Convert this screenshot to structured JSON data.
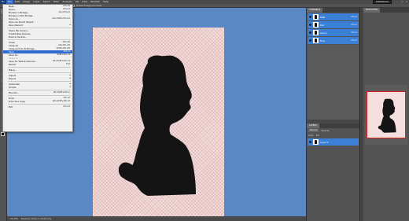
{
  "menubar": {
    "logo": "Ps",
    "items": [
      "File",
      "Edit",
      "Image",
      "Layer",
      "Select",
      "Filter",
      "Analysis",
      "3D",
      "View",
      "Window",
      "Help"
    ],
    "workspace_label": "ESSENTIALS"
  },
  "options": {
    "sample_label": "Protect Foreground Color"
  },
  "file_menu": {
    "items": [
      {
        "label": "New...",
        "shortcut": "Ctrl+N"
      },
      {
        "label": "Open...",
        "shortcut": "Ctrl+O"
      },
      {
        "label": "Browse in Bridge...",
        "shortcut": "Alt+Ctrl+O"
      },
      {
        "label": "Browse in Mini Bridge...",
        "shortcut": ""
      },
      {
        "label": "Open As...",
        "shortcut": "Alt+Shift+Ctrl+O"
      },
      {
        "label": "Open As Smart Object...",
        "shortcut": ""
      },
      {
        "label": "Open Recent",
        "shortcut": ""
      },
      {
        "label": "Share My Screen...",
        "shortcut": ""
      },
      {
        "label": "Create New Review...",
        "shortcut": ""
      },
      {
        "label": "Device Central...",
        "shortcut": ""
      },
      {
        "label": "Close",
        "shortcut": "Ctrl+W"
      },
      {
        "label": "Close All",
        "shortcut": "Alt+Ctrl+W"
      },
      {
        "label": "Close and Go To Bridge...",
        "shortcut": "Shift+Ctrl+W"
      },
      {
        "label": "Save",
        "shortcut": "Ctrl+S"
      },
      {
        "label": "Save As...",
        "shortcut": "Shift+Ctrl+S"
      },
      {
        "label": "Check In...",
        "shortcut": ""
      },
      {
        "label": "Save for Web & Devices...",
        "shortcut": "Alt+Shift+Ctrl+S"
      },
      {
        "label": "Revert",
        "shortcut": "F12"
      },
      {
        "label": "Place...",
        "shortcut": ""
      },
      {
        "label": "Import",
        "shortcut": ""
      },
      {
        "label": "Export",
        "shortcut": ""
      },
      {
        "label": "Automate",
        "shortcut": ""
      },
      {
        "label": "Scripts",
        "shortcut": ""
      },
      {
        "label": "File Info...",
        "shortcut": "Alt+Shift+Ctrl+I"
      },
      {
        "label": "Print...",
        "shortcut": "Ctrl+P"
      },
      {
        "label": "Print One Copy",
        "shortcut": "Alt+Shift+Ctrl+P"
      },
      {
        "label": "Exit",
        "shortcut": "Ctrl+Q"
      }
    ],
    "submenu_arrow": "▸"
  },
  "channels_panel": {
    "tabs": [
      "CHANNELS"
    ],
    "rows": [
      {
        "name": "RGB",
        "shortcut": "Ctrl+2"
      },
      {
        "name": "Red",
        "shortcut": "Ctrl+3"
      },
      {
        "name": "Green",
        "shortcut": "Ctrl+4"
      },
      {
        "name": "Blue",
        "shortcut": "Ctrl+5"
      }
    ]
  },
  "layers_panel": {
    "tabs": [
      "LAYERS"
    ],
    "blend_mode": "Normal",
    "opacity_label": "Opacity:",
    "lock_label": "Lock:",
    "fill_label": "Fill:",
    "layer_name": "Layer 0"
  },
  "navigator_panel": {
    "tabs": [
      "NAVIGATOR"
    ]
  },
  "status": {
    "zoom": "33.33%",
    "doc": "Exposure works in 32-bit only"
  },
  "colors": {
    "workspace": "#5a88c4",
    "highlight": "#2e6ad0",
    "canvas": "#f4dede"
  },
  "tools": [
    "move-tool",
    "marquee-tool",
    "lasso-tool",
    "quick-select-tool",
    "crop-tool",
    "eyedropper-tool",
    "healing-tool",
    "brush-tool",
    "clone-tool",
    "history-brush-tool",
    "eraser-tool",
    "gradient-tool",
    "blur-tool",
    "dodge-tool",
    "pen-tool",
    "type-tool",
    "path-select-tool",
    "shape-tool",
    "3d-tool",
    "hand-tool",
    "zoom-tool"
  ]
}
